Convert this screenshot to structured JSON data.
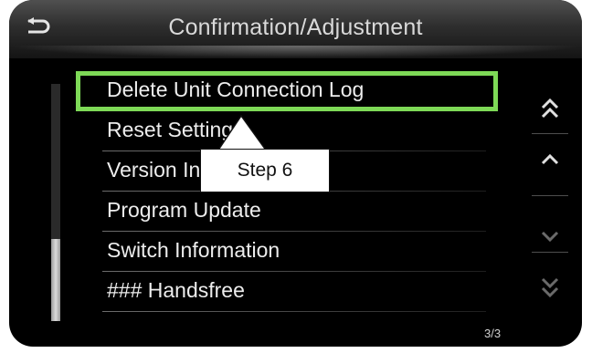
{
  "header": {
    "title": "Confirmation/Adjustment",
    "back_icon": "return-arrow-icon"
  },
  "menu": {
    "items": [
      {
        "label": "Delete Unit Connection Log",
        "selected": true
      },
      {
        "label": "Reset Settings"
      },
      {
        "label": "Version Information"
      },
      {
        "label": "Program Update"
      },
      {
        "label": "Switch Information"
      },
      {
        "label": "### Handsfree"
      }
    ]
  },
  "scroll_buttons": {
    "page_up_icon": "double-chevron-up-icon",
    "up_icon": "chevron-up-icon",
    "down_icon": "chevron-down-icon",
    "page_down_icon": "double-chevron-down-icon"
  },
  "page_indicator": "3/3",
  "annotation": {
    "callout_text": "Step 6",
    "highlight_color": "#7ed957"
  },
  "scroll_position": 1.0
}
